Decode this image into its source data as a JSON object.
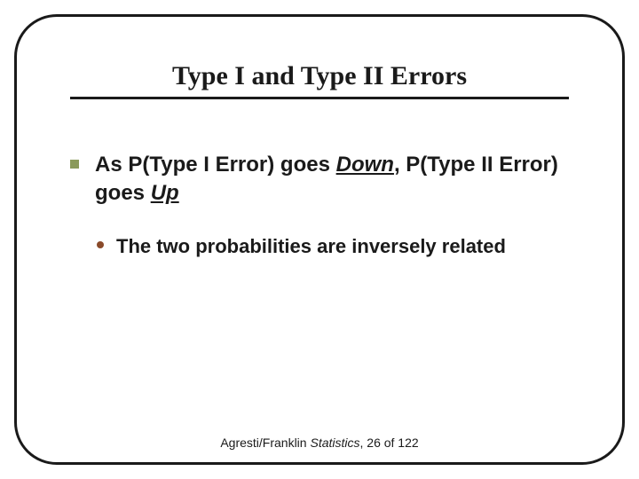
{
  "slide": {
    "title": "Type I and Type II Errors",
    "bullet": {
      "pre": "As P(Type I Error) goes ",
      "word1": "Down",
      "mid": ", P(Type II Error) goes ",
      "word2": "Up"
    },
    "sub": "The two probabilities are inversely related",
    "footer": {
      "pre": "Agresti/Franklin ",
      "ital": "Statistics",
      "post": ", 26 of 122"
    }
  }
}
